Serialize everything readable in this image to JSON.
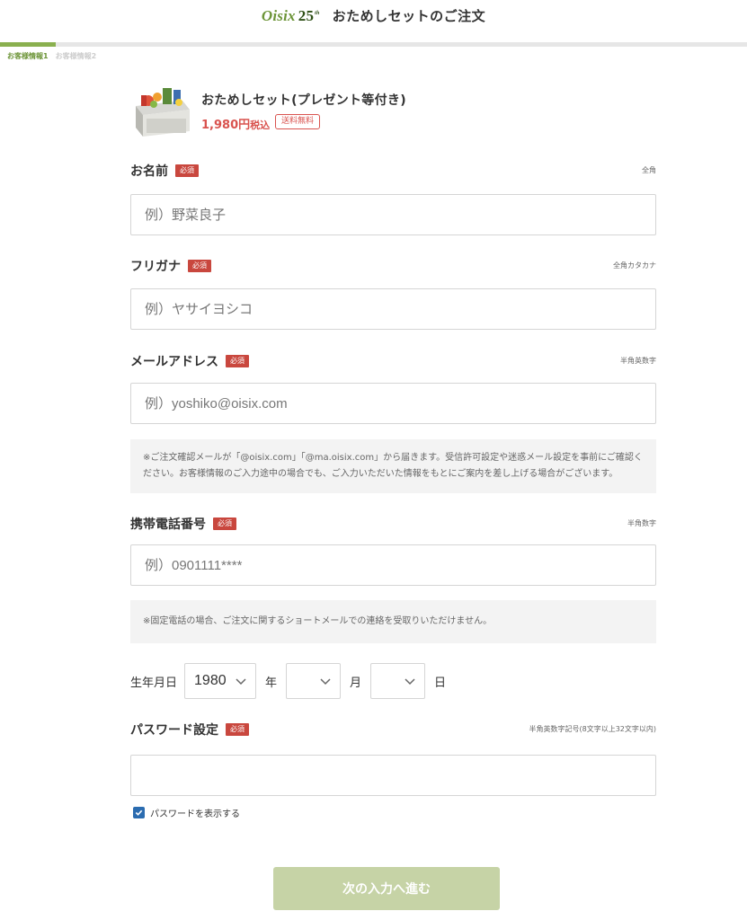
{
  "header": {
    "logo_text": "Oisix",
    "logo_num": "25",
    "logo_sup": "th",
    "title": "おためしセットのご注文"
  },
  "steps": {
    "step1": "お客様情報1",
    "step2": "お客様情報2"
  },
  "progress": {
    "fraction": 0.075,
    "color": "#8ab04f"
  },
  "product": {
    "name": "おためしセット(プレゼント等付き)",
    "price": "1,980円",
    "tax": "税込",
    "shipping": "送料無料"
  },
  "form": {
    "name": {
      "label": "お名前",
      "required": "必須",
      "hint": "全角",
      "placeholder": "例）野菜良子"
    },
    "kana": {
      "label": "フリガナ",
      "required": "必須",
      "hint": "全角カタカナ",
      "placeholder": "例）ヤサイヨシコ"
    },
    "email": {
      "label": "メールアドレス",
      "required": "必須",
      "hint": "半角英数字",
      "placeholder": "例）yoshiko@oisix.com",
      "note": "※ご注文確認メールが「@oisix.com」「@ma.oisix.com」から届きます。受信許可設定や迷惑メール設定を事前にご確認ください。お客様情報のご入力途中の場合でも、ご入力いただいた情報をもとにご案内を差し上げる場合がございます。"
    },
    "phone": {
      "label": "携帯電話番号",
      "required": "必須",
      "hint": "半角数字",
      "placeholder": "例）0901111****",
      "note": "※固定電話の場合、ご注文に関するショートメールでの連絡を受取りいただけません。"
    },
    "birth": {
      "label": "生年月日",
      "year": "1980",
      "year_unit": "年",
      "month": "",
      "month_unit": "月",
      "day": "",
      "day_unit": "日"
    },
    "password": {
      "label": "パスワード設定",
      "required": "必須",
      "hint": "半角英数字記号(8文字以上32文字以内)",
      "value": "",
      "show_label": "パスワードを表示する",
      "show_checked": true
    }
  },
  "submit_label": "次の入力へ進む",
  "colors": {
    "brand_green": "#6c9437",
    "required_red": "#c9473e",
    "price_red": "#d9534f",
    "button_disabled": "#c6d3a6",
    "checkbox_blue": "#2b6cb0"
  },
  "icons": {
    "chevron": "chevron-down-icon",
    "check": "check-icon",
    "product": "product-box-image"
  }
}
